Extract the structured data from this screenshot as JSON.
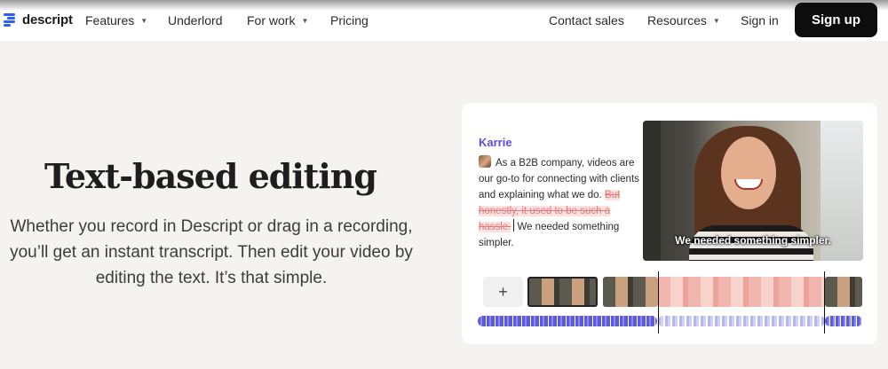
{
  "brand": {
    "name": "descript",
    "accent": "#2f5ff0"
  },
  "nav": {
    "features": "Features",
    "underlord": "Underlord",
    "for_work": "For work",
    "pricing": "Pricing",
    "contact_sales": "Contact sales",
    "resources": "Resources",
    "sign_in": "Sign in",
    "sign_up": "Sign up"
  },
  "hero": {
    "title": "Text-based editing",
    "body": "Whether you record in Descript or drag in a recording, you’ll get an instant transcript. Then edit your video by editing the text. It’s that simple."
  },
  "demo": {
    "speaker": "Karrie",
    "transcript_before": "As a B2B company, videos are our go-to for connecting with clients and explaining what we do.",
    "transcript_struck": "But honestly, it used to be such a hassle.",
    "transcript_after": "We needed something simpler.",
    "caption": "We needed something simpler.",
    "add_clip_label": "+"
  },
  "colors": {
    "struck_text": "#e07b7b",
    "struck_bg": "#fbe1df",
    "waveform": "#5b5bdc",
    "speaker": "#5b4de0"
  }
}
